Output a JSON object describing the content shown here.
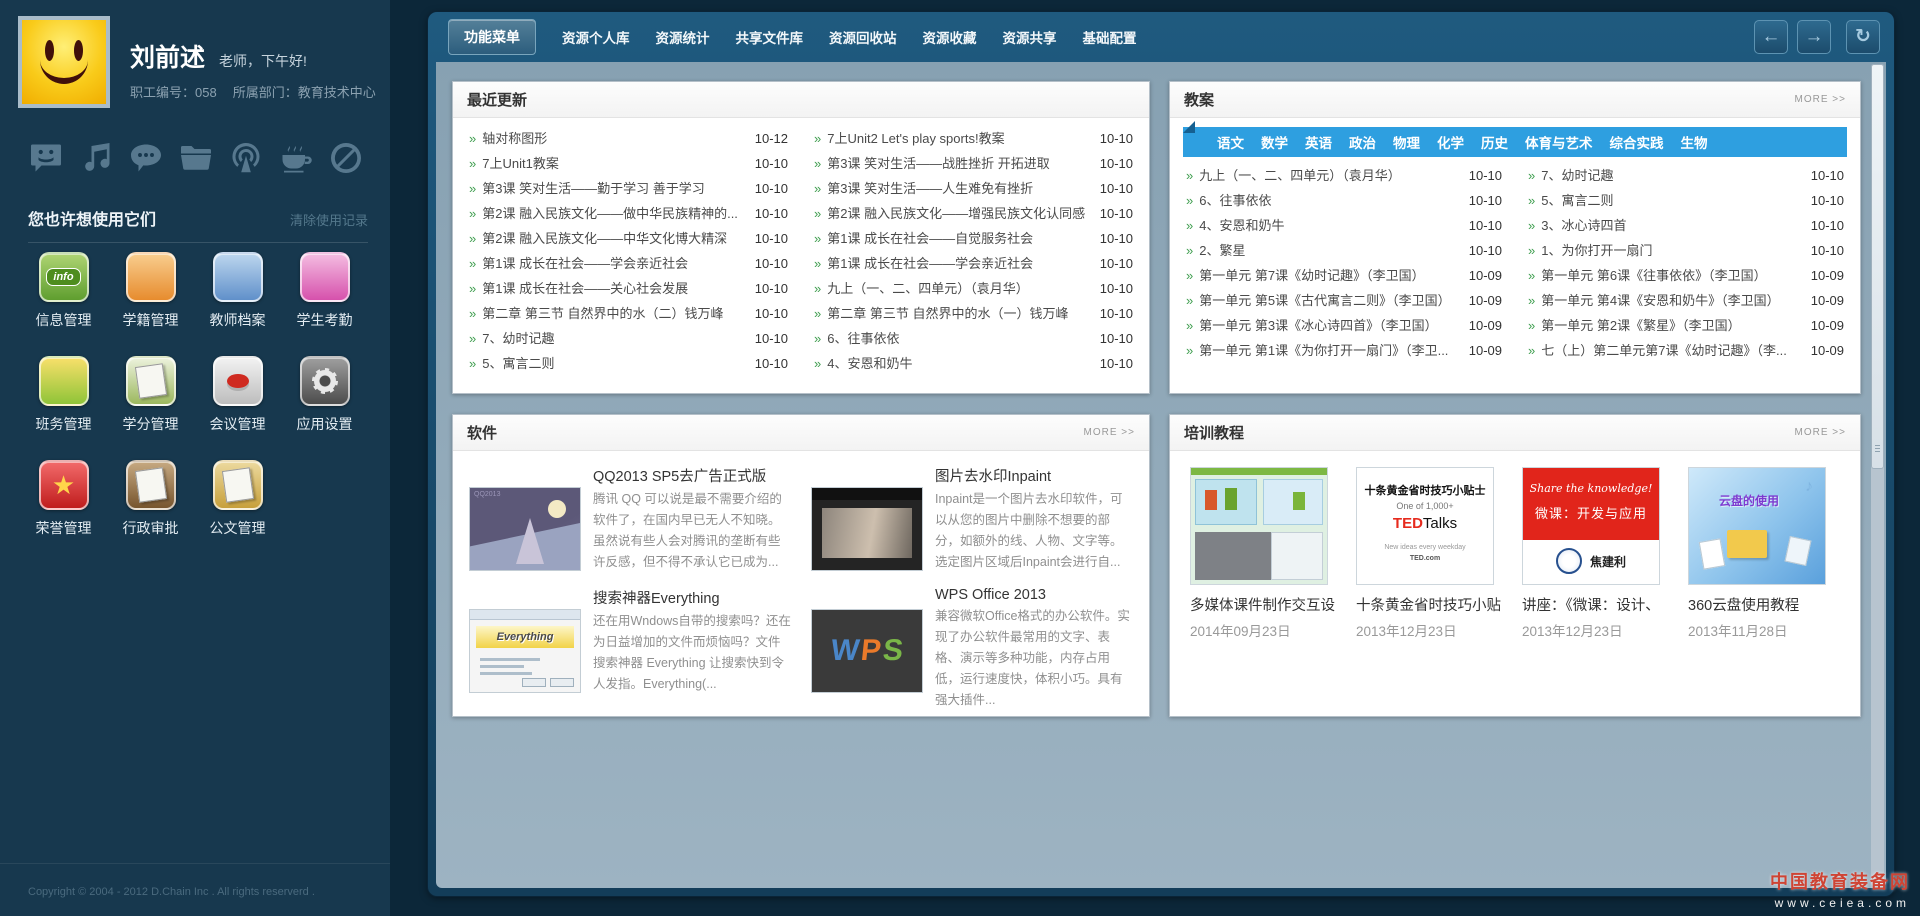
{
  "glyphs": {
    "bullet": "»",
    "back": "←",
    "forward": "→",
    "refresh": "↻"
  },
  "sidebar": {
    "user": {
      "name": "刘前述",
      "greeting": "老师，下午好!",
      "staff_no": "职工编号：058",
      "department": "所属部门：教育技术中心"
    },
    "quick_icons": [
      "message-icon",
      "music-icon",
      "comment-icon",
      "folder-icon",
      "broadcast-icon",
      "coffee-icon",
      "block-icon"
    ],
    "suggest_title": "您也许想使用它们",
    "clear_history": "清除使用记录",
    "apps": [
      {
        "label": "信息管理",
        "badge": "info"
      },
      {
        "label": "学籍管理"
      },
      {
        "label": "教师档案"
      },
      {
        "label": "学生考勤"
      },
      {
        "label": "班务管理"
      },
      {
        "label": "学分管理"
      },
      {
        "label": "会议管理"
      },
      {
        "label": "应用设置"
      },
      {
        "label": "荣誉管理",
        "star": "★"
      },
      {
        "label": "行政审批"
      },
      {
        "label": "公文管理"
      }
    ],
    "copyright": "Copyright © 2004 - 2012 D.Chain Inc . All rights reserverd ."
  },
  "topnav": {
    "active": "功能菜单",
    "items": [
      "资源个人库",
      "资源统计",
      "共享文件库",
      "资源回收站",
      "资源收藏",
      "资源共享",
      "基础配置"
    ]
  },
  "panels": {
    "recent": {
      "title": "最近更新",
      "col1": [
        {
          "t": "轴对称图形",
          "d": "10-12"
        },
        {
          "t": "7上Unit1教案",
          "d": "10-10"
        },
        {
          "t": "第3课 笑对生活——勤于学习 善于学习",
          "d": "10-10"
        },
        {
          "t": "第2课 融入民族文化——做中华民族精神的...",
          "d": "10-10"
        },
        {
          "t": "第2课 融入民族文化——中华文化博大精深",
          "d": "10-10"
        },
        {
          "t": "第1课 成长在社会——学会亲近社会",
          "d": "10-10"
        },
        {
          "t": "第1课 成长在社会——关心社会发展",
          "d": "10-10"
        },
        {
          "t": "第二章 第三节 自然界中的水（二）钱万峰",
          "d": "10-10"
        },
        {
          "t": "7、幼时记趣",
          "d": "10-10"
        },
        {
          "t": "5、寓言二则",
          "d": "10-10"
        }
      ],
      "col2": [
        {
          "t": "7上Unit2 Let's play sports!教案",
          "d": "10-10"
        },
        {
          "t": "第3课 笑对生活——战胜挫折 开拓进取",
          "d": "10-10"
        },
        {
          "t": "第3课 笑对生活——人生难免有挫折",
          "d": "10-10"
        },
        {
          "t": "第2课 融入民族文化——增强民族文化认同感",
          "d": "10-10"
        },
        {
          "t": "第1课 成长在社会——自觉服务社会",
          "d": "10-10"
        },
        {
          "t": "第1课 成长在社会——学会亲近社会",
          "d": "10-10"
        },
        {
          "t": "九上（一、二、四单元）（袁月华）",
          "d": "10-10"
        },
        {
          "t": "第二章 第三节 自然界中的水（一）钱万峰",
          "d": "10-10"
        },
        {
          "t": "6、往事依依",
          "d": "10-10"
        },
        {
          "t": "4、安恩和奶牛",
          "d": "10-10"
        }
      ]
    },
    "lesson": {
      "title": "教案",
      "more": "MORE >>",
      "tabs": [
        "语文",
        "数学",
        "英语",
        "政治",
        "物理",
        "化学",
        "历史",
        "体育与艺术",
        "综合实践",
        "生物"
      ],
      "col1": [
        {
          "t": "九上（一、二、四单元）（袁月华）",
          "d": "10-10"
        },
        {
          "t": "6、往事依依",
          "d": "10-10"
        },
        {
          "t": "4、安恩和奶牛",
          "d": "10-10"
        },
        {
          "t": "2、繁星",
          "d": "10-10"
        },
        {
          "t": "第一单元 第7课《幼时记趣》（李卫国）",
          "d": "10-09"
        },
        {
          "t": "第一单元 第5课《古代寓言二则》（李卫国）",
          "d": "10-09"
        },
        {
          "t": "第一单元 第3课《冰心诗四首》（李卫国）",
          "d": "10-09"
        },
        {
          "t": "第一单元 第1课《为你打开一扇门》（李卫...",
          "d": "10-09"
        }
      ],
      "col2": [
        {
          "t": "7、幼时记趣",
          "d": "10-10"
        },
        {
          "t": "5、寓言二则",
          "d": "10-10"
        },
        {
          "t": "3、冰心诗四首",
          "d": "10-10"
        },
        {
          "t": "1、为你打开一扇门",
          "d": "10-10"
        },
        {
          "t": "第一单元 第6课《往事依依》（李卫国）",
          "d": "10-09"
        },
        {
          "t": "第一单元 第4课《安恩和奶牛》（李卫国）",
          "d": "10-09"
        },
        {
          "t": "第一单元 第2课《繁星》（李卫国）",
          "d": "10-09"
        },
        {
          "t": "七（上）第二单元第7课《幼时记趣》（李...",
          "d": "10-09"
        }
      ]
    },
    "software": {
      "title": "软件",
      "more": "MORE >>",
      "items": [
        {
          "title": "QQ2013 SP5去广告正式版",
          "desc": "腾讯 QQ 可以说是最不需要介绍的软件了，在国内早已无人不知晓。虽然说有些人会对腾讯的垄断有些许反感，但不得不承认它已成为...",
          "thumb_label": "QQ2013"
        },
        {
          "title": "图片去水印Inpaint",
          "desc": "Inpaint是一个图片去水印软件，可以从您的图片中删除不想要的部分，如额外的线、人物、文字等。选定图片区域后Inpaint会进行自..."
        },
        {
          "title": "搜索神器Everything",
          "desc": "还在用Wndows自带的搜索吗？还在为日益增加的文件而烦恼吗？文件搜索神器 Everything 让搜索快到令人发指。Everything(...",
          "thumb_label": "Everything"
        },
        {
          "title": "WPS Office 2013",
          "desc": "兼容微软Office格式的办公软件。实现了办公软件最常用的文字、表格、演示等多种功能，内存占用低，运行速度快，体积小巧。具有强大插件...",
          "letters": {
            "w": "W",
            "p": "P",
            "s": "S"
          }
        }
      ]
    },
    "training": {
      "title": "培训教程",
      "more": "MORE >>",
      "items": [
        {
          "caption": "多媒体课件制作交互设",
          "date": "2014年09月23日"
        },
        {
          "caption": "十条黄金省时技巧小贴",
          "date": "2013年12月23日",
          "thumb": {
            "l1": "十条黄金省时技巧小贴士",
            "l2": "One of 1,000+",
            "ted": "TED",
            "talks": "Talks",
            "l4": "New ideas every weekday",
            "l5": "TED.com"
          }
        },
        {
          "caption": "讲座：《微课：设计、",
          "date": "2013年12月23日",
          "thumb": {
            "script": "Share the knowledge!",
            "title": "微课：开发与应用",
            "author": "焦建利"
          }
        },
        {
          "caption": "360云盘使用教程",
          "date": "2013年11月28日",
          "thumb": {
            "text": "云盘的使用"
          }
        }
      ]
    }
  },
  "watermark": {
    "line1": "中国教育装备网",
    "line2": "www.ceiea.com"
  }
}
